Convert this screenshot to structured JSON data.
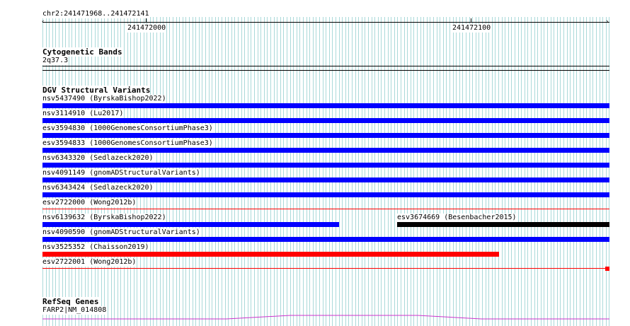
{
  "ruler": {
    "region": "chr2:241471968..241472141",
    "ticks": [
      "241472000",
      "241472100"
    ],
    "arrow_left": "‹",
    "arrow_right": "›"
  },
  "cytoband": {
    "title": "Cytogenetic Bands",
    "band": "2q37.3"
  },
  "dgv": {
    "title": "DGV Structural Variants",
    "variants": [
      {
        "label": "nsv5437490 (ByrskaBishop2022)",
        "color": "#0000ff"
      },
      {
        "label": "nsv3114910 (Lu2017)",
        "color": "#0000ff"
      },
      {
        "label": "esv3594830 (1000GenomesConsortiumPhase3)",
        "color": "#0000ff"
      },
      {
        "label": "esv3594833 (1000GenomesConsortiumPhase3)",
        "color": "#0000ff"
      },
      {
        "label": "nsv6343320 (Sedlazeck2020)",
        "color": "#0000ff"
      },
      {
        "label": "nsv4091149 (gnomADStructuralVariants)",
        "color": "#0000ff"
      },
      {
        "label": "nsv6343424 (Sedlazeck2020)",
        "color": "#0000ff"
      },
      {
        "label": "esv2722000 (Wong2012b)",
        "color": "#ff0000"
      },
      {
        "label": "nsv6139632 (ByrskaBishop2022)",
        "color": "#0000ff"
      },
      {
        "label": "esv3674669 (Besenbacher2015)",
        "color": "#000000"
      },
      {
        "label": "nsv4090590 (gnomADStructuralVariants)",
        "color": "#0000ff"
      },
      {
        "label": "nsv3525352 (Chaisson2019)",
        "color": "#ff0000"
      },
      {
        "label": "esv2722001 (Wong2012b)",
        "color": "#ff0000"
      }
    ]
  },
  "refseq": {
    "title": "RefSeq Genes",
    "gene": "FARP2|NM_014808",
    "color": "#cc33cc"
  },
  "colors": {
    "grid": "#66bbbb",
    "gain": "#0000ff",
    "loss": "#ff0000",
    "complex": "#000000"
  }
}
